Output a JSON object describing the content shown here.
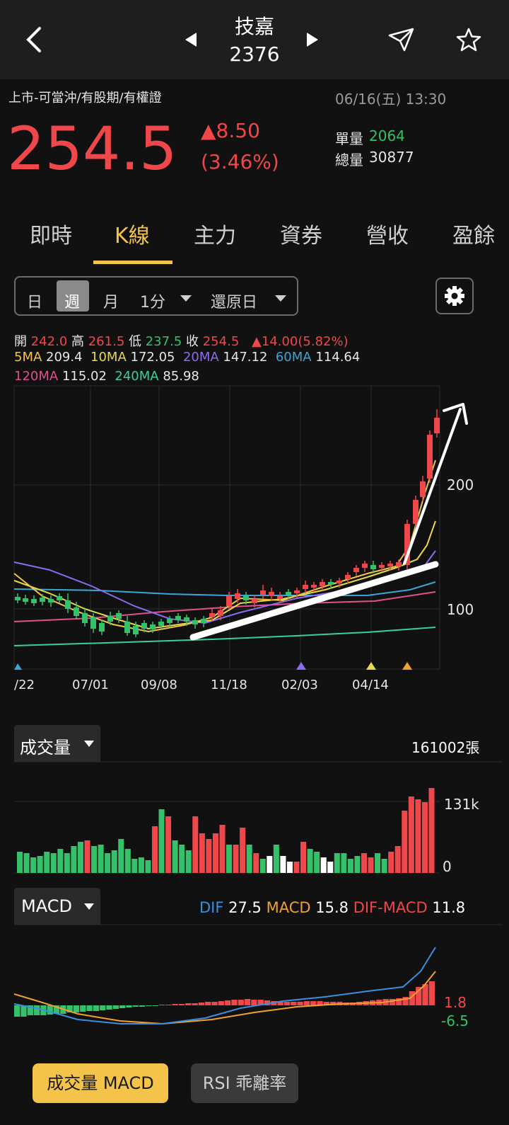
{
  "header": {
    "stock_name": "技嘉",
    "stock_code": "2376"
  },
  "quote": {
    "tags": "上市-可當沖/有股期/有權證",
    "datetime": "06/16(五) 13:30",
    "price": "254.5",
    "change": "▲8.50",
    "change_pct": "(3.46%)",
    "unit_vol_label": "單量",
    "unit_vol": "2064",
    "total_vol_label": "總量",
    "total_vol": "30877"
  },
  "tabs": [
    "即時",
    "K線",
    "主力",
    "資券",
    "營收",
    "盈餘"
  ],
  "selected_tab": "K線",
  "period_selector": {
    "options": [
      "日",
      "週",
      "月"
    ],
    "selected": "週",
    "minute": "1分",
    "adjust": "還原日"
  },
  "ohlc": {
    "open_label": "開",
    "open": "242.0",
    "high_label": "高",
    "high": "261.5",
    "low_label": "低",
    "low": "237.5",
    "close_label": "收",
    "close": "254.5",
    "change": "▲14.00(5.82%)"
  },
  "ma": {
    "ma5_label": "5MA",
    "ma5": "209.4",
    "ma10_label": "10MA",
    "ma10": "172.05",
    "ma20_label": "20MA",
    "ma20": "147.12",
    "ma60_label": "60MA",
    "ma60": "114.64",
    "ma120_label": "120MA",
    "ma120": "115.02",
    "ma240_label": "240MA",
    "ma240": "85.98"
  },
  "colors": {
    "up": "#f0474b",
    "down": "#35c06a",
    "accent": "#f3c34a",
    "ma5": "#f3c34a",
    "ma10": "#e8d84a",
    "ma20": "#8b6cf0",
    "ma60": "#3aa6d8",
    "ma120": "#e0508a",
    "ma240": "#3ccf9a",
    "dif": "#3a8fe0",
    "macd": "#f0a030"
  },
  "chart_data": [
    {
      "type": "candlestick",
      "x_tick_labels": [
        "/22",
        "07/01",
        "09/08",
        "11/18",
        "02/03",
        "04/14"
      ],
      "y_tick_labels": [
        "200",
        "100"
      ],
      "last_bar": {
        "open": 242.0,
        "high": 261.5,
        "low": 237.5,
        "close": 254.5
      },
      "ma": {
        "5MA": 209.4,
        "10MA": 172.05,
        "20MA": 147.12,
        "60MA": 114.64,
        "120MA": 115.02,
        "240MA": 85.98
      }
    },
    {
      "type": "bar",
      "selector": "成交量",
      "total": "161002張",
      "y_tick_labels": [
        "131k",
        "0"
      ]
    },
    {
      "type": "bar",
      "selector": "MACD",
      "dif_label": "DIF",
      "dif": "27.5",
      "macd_label": "MACD",
      "macd": "15.8",
      "osc_label": "DIF-MACD",
      "osc": "11.8",
      "y_tick_labels": [
        "1.8",
        "-6.5"
      ]
    }
  ],
  "bottom_buttons": [
    "成交量 MACD",
    "RSI 乖離率"
  ]
}
